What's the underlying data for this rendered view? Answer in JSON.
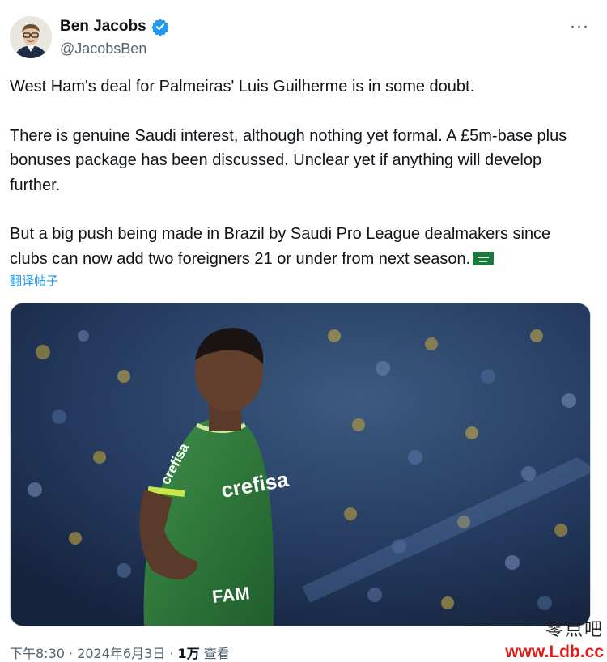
{
  "author": {
    "display_name": "Ben Jacobs",
    "handle": "@JacobsBen",
    "verified_icon": "verified-badge-icon",
    "verified_color": "#1d9bf0"
  },
  "menu": {
    "more_label": "···"
  },
  "tweet": {
    "paragraph_1": "West Ham's deal for Palmeiras' Luis Guilherme is in some doubt.",
    "paragraph_2": "There is genuine Saudi interest, although nothing yet formal. A £5m-base plus bonuses package has been discussed. Unclear yet if anything will develop further.",
    "paragraph_3": "But a big push being made in Brazil by Saudi Pro League dealmakers since clubs can now add two foreigners 21 or under from next season.",
    "flag_icon": "saudi-flag-emoji",
    "translate_label": "翻译帖子"
  },
  "media": {
    "jersey_sponsor": "crefisa",
    "jersey_chest": "crefisa",
    "jersey_bottom": "FAM",
    "accent_color": "#2e7d32"
  },
  "footer": {
    "timestamp": "下午8:30 · 2024年6月3日 · ",
    "views_count": "1万",
    "views_label": " 查看"
  },
  "watermark": {
    "site_name": "零点吧",
    "url": "www.Ldb.cc"
  }
}
